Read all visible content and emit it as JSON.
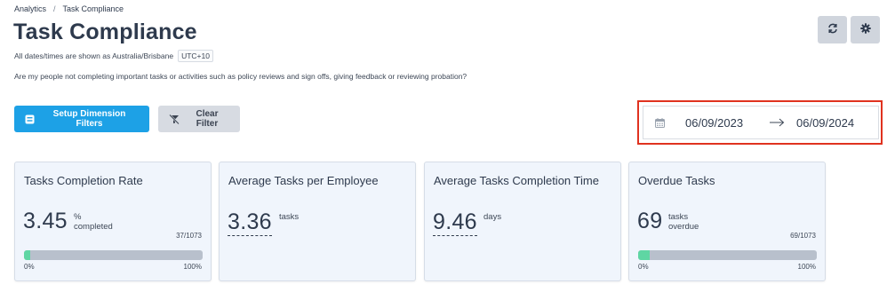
{
  "breadcrumb": {
    "parent": "Analytics",
    "separator": "/",
    "current": "Task Compliance"
  },
  "page": {
    "title": "Task Compliance",
    "timezone_note": "All dates/times are shown as Australia/Brisbane",
    "timezone_badge": "UTC+10",
    "description": "Are my people not completing important tasks or activities such as policy reviews and sign offs, giving feedback or reviewing probation?"
  },
  "toolbar": {
    "setup_filters_label": "Setup Dimension Filters",
    "clear_filter_label": "Clear Filter",
    "refresh_icon": "refresh-icon",
    "settings_icon": "gear-icon"
  },
  "date_range": {
    "start": "06/09/2023",
    "arrow": "⟶",
    "end": "06/09/2024",
    "icon": "calendar-icon"
  },
  "colors": {
    "primary": "#1da1e6",
    "progress_fill": "#5fd6a3",
    "progress_track": "#b8c0cc",
    "highlight": "#e0321f"
  },
  "cards": [
    {
      "title": "Tasks Completion Rate",
      "value": "3.45",
      "unit_line1": "%",
      "unit_line2": "completed",
      "ratio": "37/1073",
      "progress_fraction": 0.0345,
      "min_label": "0%",
      "max_label": "100%"
    },
    {
      "title": "Average Tasks per Employee",
      "value": "3.36",
      "unit_line1": "tasks"
    },
    {
      "title": "Average Tasks Completion Time",
      "value": "9.46",
      "unit_line1": "days"
    },
    {
      "title": "Overdue Tasks",
      "value": "69",
      "unit_line1": "tasks",
      "unit_line2": "overdue",
      "ratio": "69/1073",
      "progress_fraction": 0.0643,
      "min_label": "0%",
      "max_label": "100%"
    }
  ]
}
